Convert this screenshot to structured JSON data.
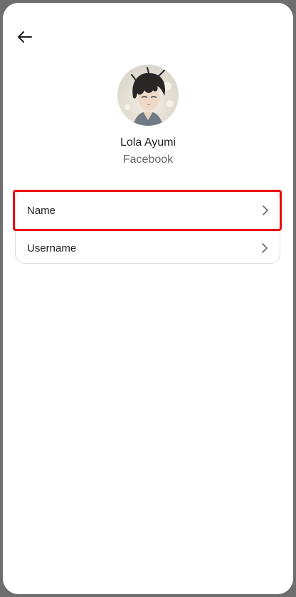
{
  "header": {
    "back_icon": "arrow-left-icon"
  },
  "profile": {
    "name": "Lola Ayumi",
    "account_type": "Facebook"
  },
  "settings": {
    "items": [
      {
        "label": "Name",
        "icon": "chevron-right-icon",
        "highlighted": true,
        "highlight_color": "#ec0b0b"
      },
      {
        "label": "Username",
        "icon": "chevron-right-icon",
        "highlighted": false
      }
    ]
  },
  "colors": {
    "text_primary": "#1c1e21",
    "text_secondary": "#65676b",
    "card_border": "#dadde1",
    "highlight": "#ec0b0b"
  }
}
